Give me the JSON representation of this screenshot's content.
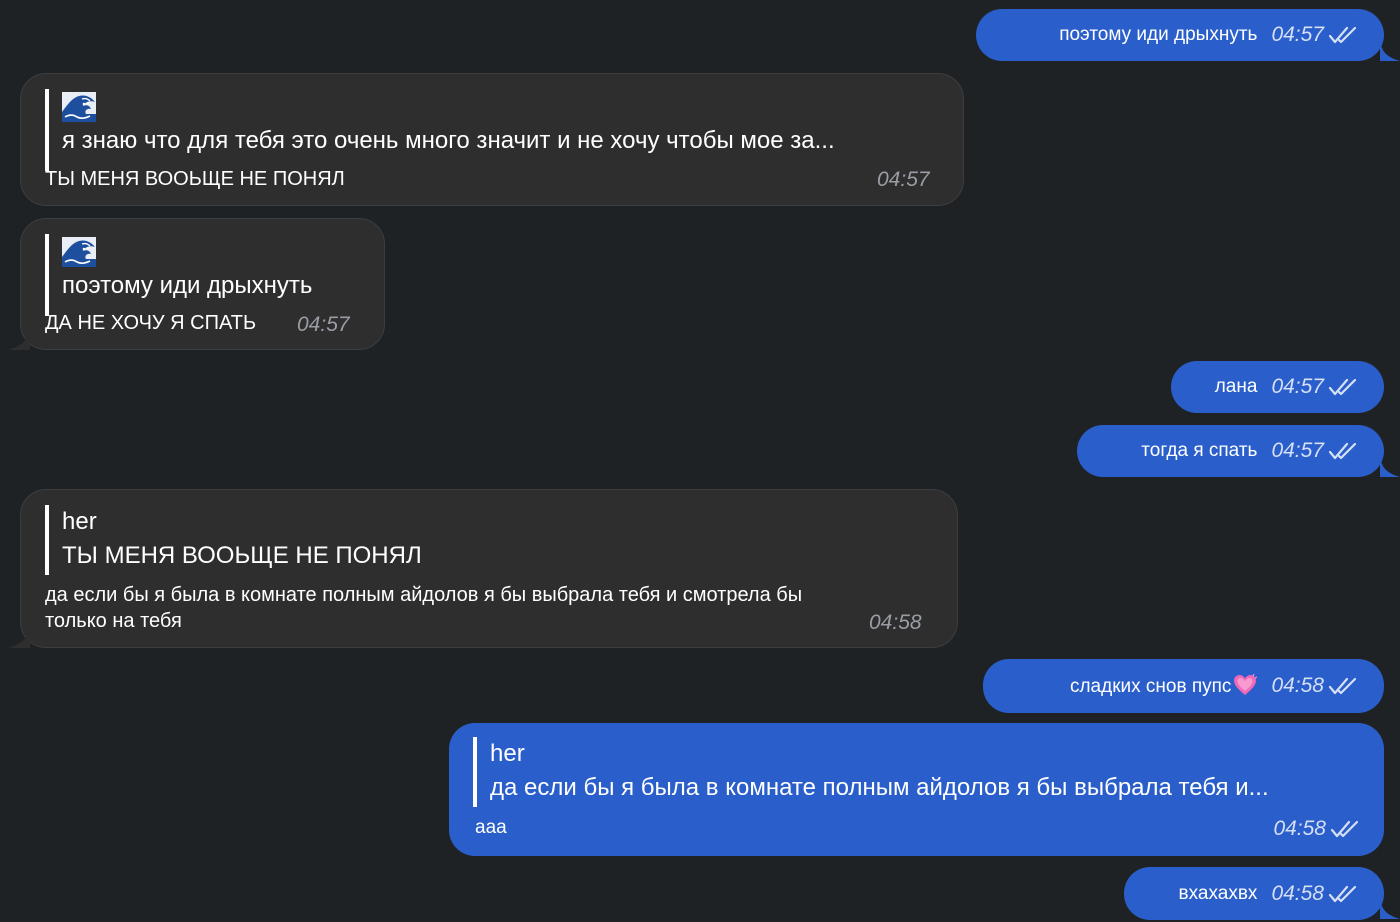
{
  "colors": {
    "background": "#1f2224",
    "incoming_bubble": "#2e2e2f",
    "outgoing_bubble": "#2a5fcb",
    "time_outgoing": "#d5dff5",
    "time_incoming": "#9a9ea4"
  },
  "messages": [
    {
      "direction": "out",
      "text": "поэтому иди дрыхнуть",
      "time": "04:57",
      "status": "read"
    },
    {
      "direction": "in",
      "reply": {
        "author_icon": "wave-emoji",
        "text": "я знаю что для тебя это очень много значит и не хочу чтобы мое за..."
      },
      "text": "ТЫ МЕНЯ ВООЬЩЕ НЕ ПОНЯЛ",
      "time": "04:57"
    },
    {
      "direction": "in",
      "reply": {
        "author_icon": "wave-emoji",
        "text": "поэтому иди дрыхнуть"
      },
      "text": "ДА НЕ ХОЧУ Я СПАТЬ",
      "time": "04:57"
    },
    {
      "direction": "out",
      "text": "лана",
      "time": "04:57",
      "status": "read"
    },
    {
      "direction": "out",
      "text": "тогда я спать",
      "time": "04:57",
      "status": "read"
    },
    {
      "direction": "in",
      "reply": {
        "author": "her",
        "text": "ТЫ МЕНЯ ВООЬЩЕ НЕ ПОНЯЛ"
      },
      "text_line1": "да если бы я была в комнате полным айдолов я бы выбрала тебя и смотрела бы",
      "text_line2": "только на тебя",
      "time": "04:58"
    },
    {
      "direction": "out",
      "text": "сладких снов пупс",
      "emoji": "pink-heart-emoji",
      "time": "04:58",
      "status": "read"
    },
    {
      "direction": "out",
      "reply": {
        "author": "her",
        "text": "да если бы я была в комнате полным айдолов я бы выбрала тебя и..."
      },
      "text": "ааа",
      "time": "04:58",
      "status": "read"
    },
    {
      "direction": "out",
      "text": "вхахахвх",
      "time": "04:58",
      "status": "read"
    }
  ]
}
